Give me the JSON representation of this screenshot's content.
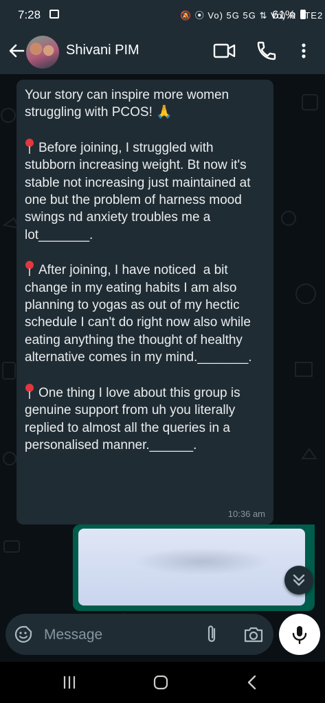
{
  "status_bar": {
    "time": "7:28",
    "network_icons": "🔕 ⦿ Vo) 5G 5G ⇅ Vo) R LTE2",
    "battery": "61%"
  },
  "header": {
    "contact_name": "Shivani PIM"
  },
  "messages": {
    "incoming": {
      "p1": "Your story can inspire more women struggling with PCOS! 🙏",
      "p2": "Before joining, I struggled with stubborn increasing weight. Bt now it's stable not increasing just maintained at one but the problem of harness mood swings nd anxiety troubles me a lot_______.",
      "p3": "After joining, I have noticed  a bit change in my eating habits I am also planning to yogas as out of my hectic schedule I can't do right now also while eating anything the thought of healthy alternative comes in my mind._______.",
      "p4": "One thing I love about this group is genuine support from uh you literally replied to almost all the queries in a personalised manner.______.",
      "time": "10:36 am"
    }
  },
  "input": {
    "placeholder": "Message"
  },
  "colors": {
    "header_bg": "#1f2c34",
    "incoming_bubble": "#202c33",
    "outgoing_bubble": "#005c4b",
    "chat_bg": "#0b1014"
  }
}
